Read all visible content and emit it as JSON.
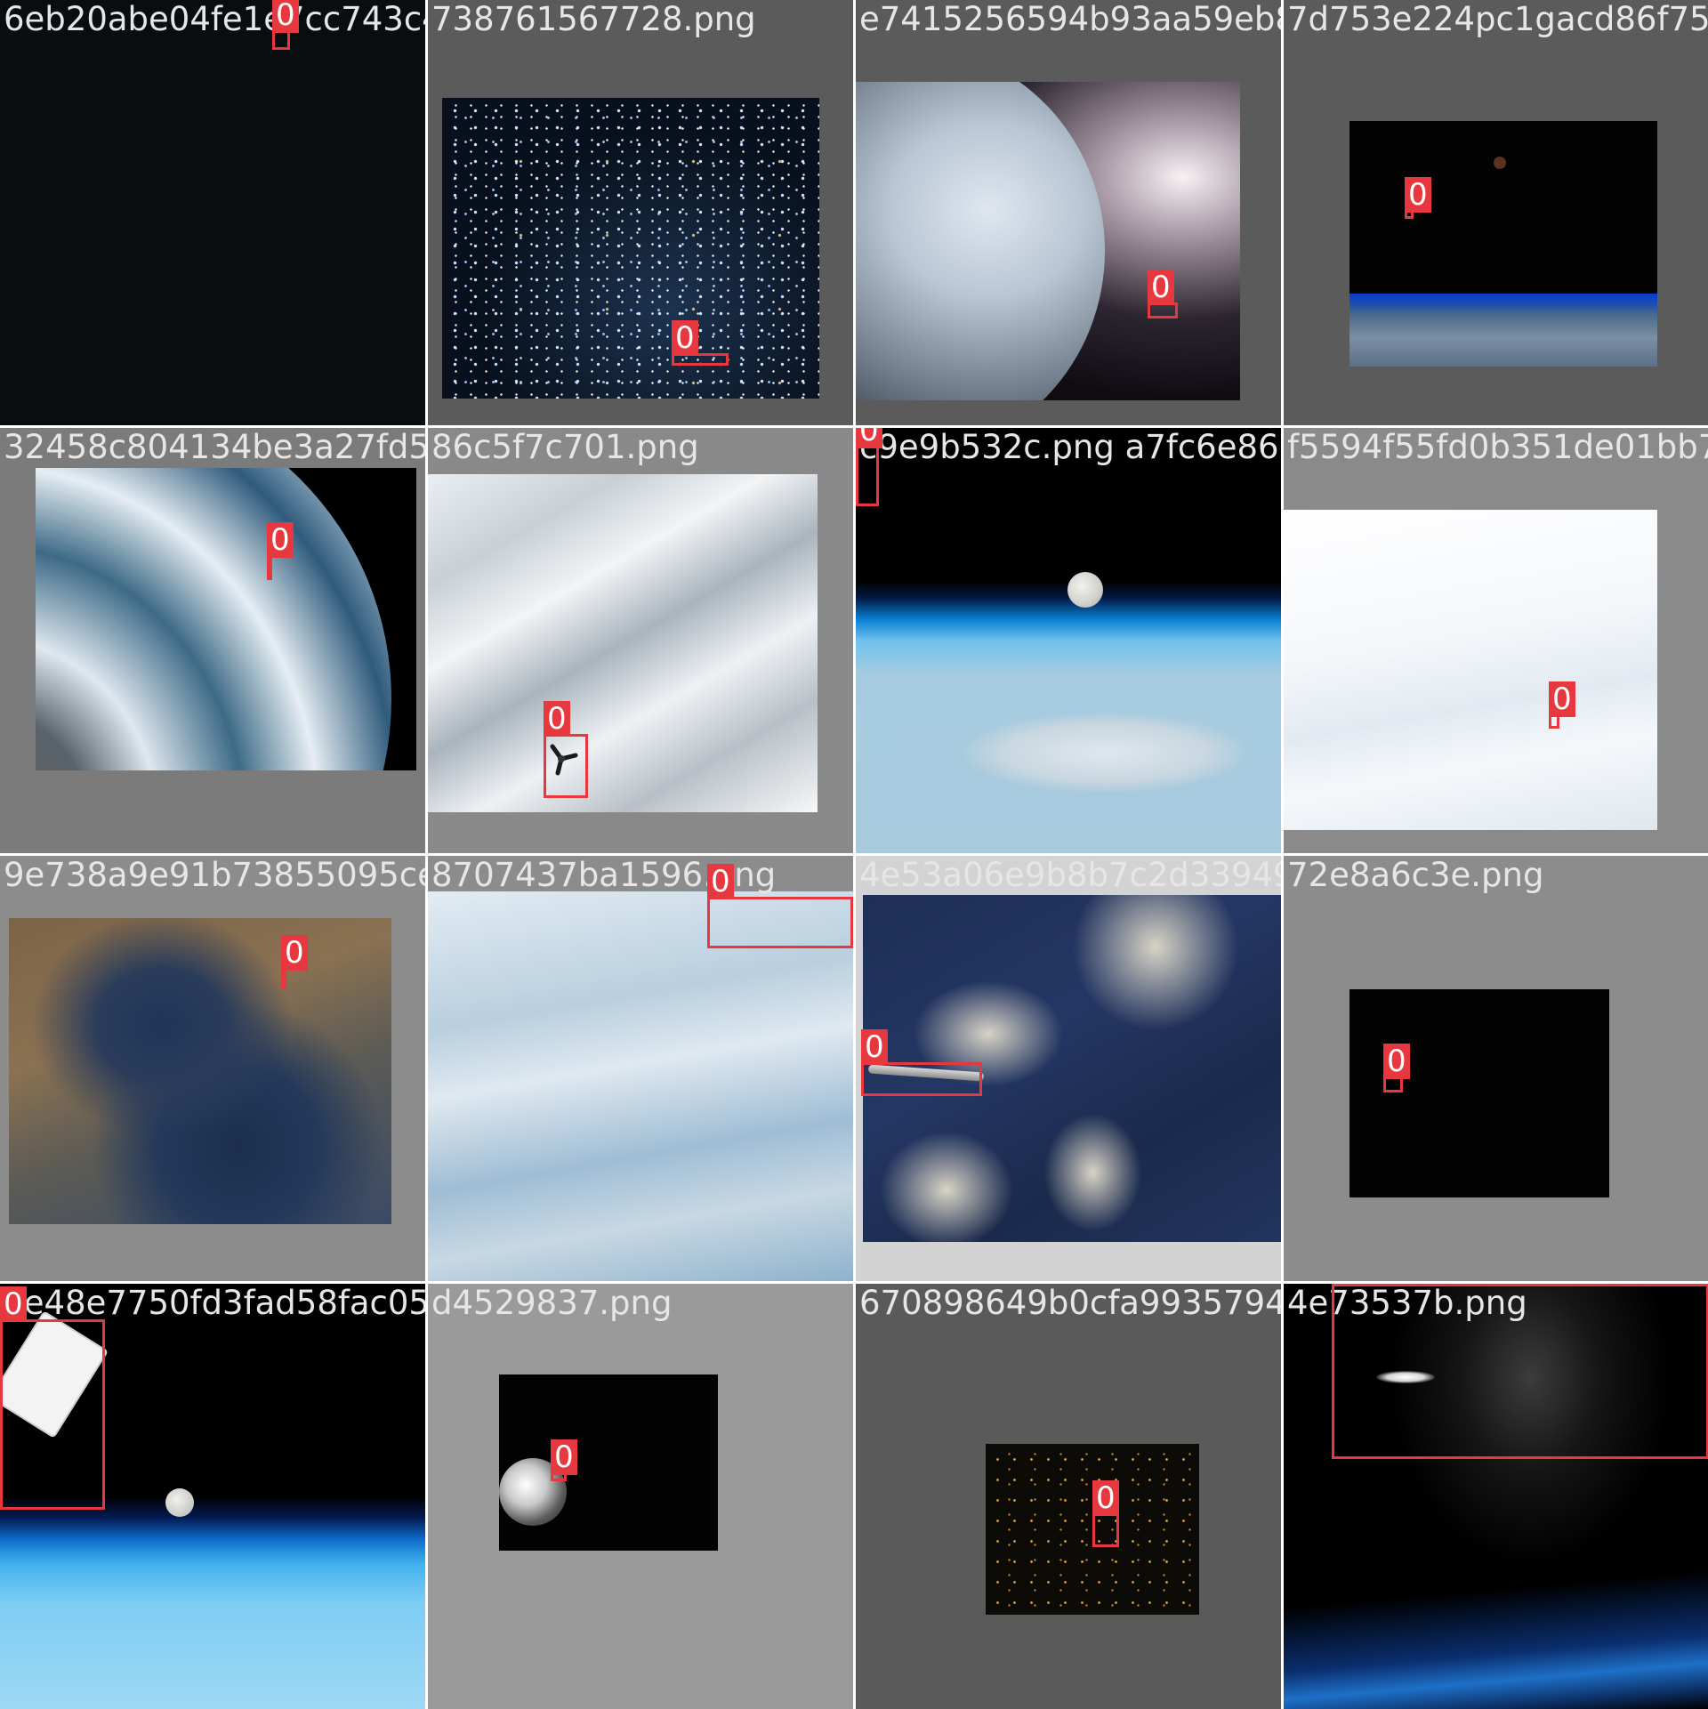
{
  "tiles": [
    {
      "filename": "6eb20abe04fe1e7cc743c4ff83f76536728ge9b186ac4e18",
      "label": "0"
    },
    {
      "filename": "738761567728.png",
      "label": "0"
    },
    {
      "filename": "e7415256594b93aa59eb8a7d753e224.png",
      "label": "0"
    },
    {
      "filename": "7d753e224pc1gacd86f7506d",
      "label": "0"
    },
    {
      "filename": "32458c804134be3a27fd59628fc55f7c701905ee58290e2d",
      "label": "0"
    },
    {
      "filename": "86c5f7c701.png",
      "label": "0"
    },
    {
      "filename": "c9e9b532c.png a7fc6e860e60f",
      "label": "0"
    },
    {
      "filename": "f5594f55fd0b351de01bb7bb",
      "label": "0"
    },
    {
      "filename": "9e738a9e91b73855095ceb7537447bde15966c0ef0f7523",
      "label": "0"
    },
    {
      "filename": "8707437ba1596.png",
      "label": "0"
    },
    {
      "filename": "4e53a06e9b8b7c2d339491dd72e8a6c3e24f2748f14dcffb2",
      "label": "0"
    },
    {
      "filename": "72e8a6c3e.png",
      "label": "0"
    },
    {
      "filename": "ee48e7750fd3fad58fac059ed4529677ea34939343c6f5",
      "label": "0"
    },
    {
      "filename": "d4529837.png",
      "label": "0"
    },
    {
      "filename": "670898649b0cfa99357940c9341735537a68181ce14197f",
      "label": "0"
    },
    {
      "filename": "4e73537b.png",
      "label": "0"
    }
  ]
}
